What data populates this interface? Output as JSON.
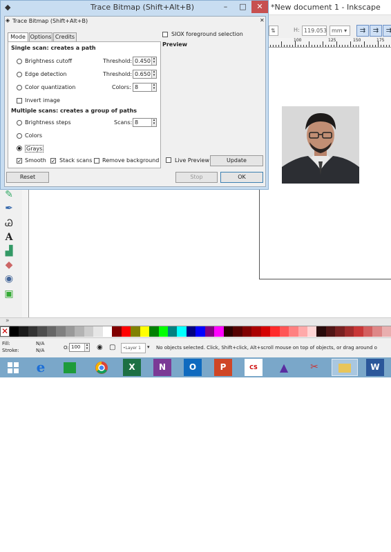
{
  "inkscape": {
    "title": "*New document 1 - Inkscape",
    "tool_controls": {
      "h_label": "H:",
      "h_value": "119.053",
      "unit": "mm"
    },
    "ruler_labels": [
      "100",
      "125",
      "150",
      "175"
    ],
    "hscroll_label": "»"
  },
  "dialog": {
    "window_title": "Trace Bitmap (Shift+Alt+B)",
    "panel_title": "Trace Bitmap (Shift+Alt+B)",
    "tabs": [
      "Mode",
      "Options",
      "Credits"
    ],
    "single_scan_heading": "Single scan: creates a path",
    "brightness_cutoff": "Brightness cutoff",
    "threshold_label": "Threshold:",
    "threshold_brightness": "0.450",
    "edge_detection": "Edge detection",
    "threshold_edge": "0.650",
    "color_quantization": "Color quantization",
    "colors_label": "Colors:",
    "colors_value": "8",
    "invert_image": "Invert image",
    "multiple_scan_heading": "Multiple scans: creates a group of paths",
    "brightness_steps": "Brightness steps",
    "scans_label": "Scans:",
    "scans_value": "8",
    "colors_option": "Colors",
    "grays_option": "Grays",
    "smooth": "Smooth",
    "stack_scans": "Stack scans",
    "remove_background": "Remove background",
    "siox": "SIOX foreground selection",
    "preview_heading": "Preview",
    "live_preview": "Live Preview",
    "update_button": "Update",
    "reset_button": "Reset",
    "stop_button": "Stop",
    "ok_button": "OK"
  },
  "status": {
    "fill_label": "Fill:",
    "fill_value": "N/A",
    "stroke_label": "Stroke:",
    "stroke_value": "N/A",
    "opacity_label": "O:",
    "opacity_value": "100",
    "layer": "•Layer 1",
    "message": "No objects selected. Click, Shift+click, Alt+scroll mouse on top of objects, or drag around o"
  },
  "taskbar": {
    "apps": [
      "windows-start",
      "internet-explorer",
      "store",
      "chrome",
      "excel",
      "onenote",
      "outlook",
      "powerpoint",
      "cs-eagle",
      "inkscape",
      "snipping-tool",
      "file-explorer",
      "word"
    ],
    "letters": {
      "excel": "X",
      "onenote": "N",
      "outlook": "O",
      "powerpoint": "P",
      "word": "W",
      "cs": "CS"
    }
  },
  "palette_colors": [
    "#000000",
    "#1a1a1a",
    "#333333",
    "#4d4d4d",
    "#666666",
    "#808080",
    "#999999",
    "#b3b3b3",
    "#cccccc",
    "#e6e6e6",
    "#ffffff",
    "#800000",
    "#ff0000",
    "#808000",
    "#ffff00",
    "#008000",
    "#00ff00",
    "#008080",
    "#00ffff",
    "#000080",
    "#0000ff",
    "#800080",
    "#ff00ff",
    "#2b0000",
    "#550000",
    "#800000",
    "#aa0000",
    "#d40000",
    "#ff2a2a",
    "#ff5555",
    "#ff8080",
    "#ffaaaa",
    "#ffd5d5",
    "#280b0b",
    "#501616",
    "#782121",
    "#a02c2c",
    "#c83737",
    "#d35f5f",
    "#de8787",
    "#e9afaf"
  ]
}
